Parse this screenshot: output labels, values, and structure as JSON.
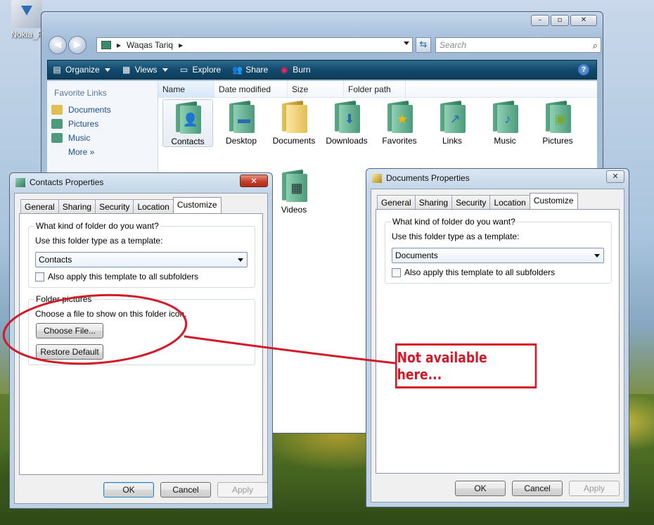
{
  "desktop": {
    "icon_label": "Nokia_P"
  },
  "explorer": {
    "address": [
      "Waqas Tariq"
    ],
    "search_placeholder": "Search",
    "toolbar": [
      {
        "label": "Organize",
        "icon": "organize-icon",
        "dropdown": true
      },
      {
        "label": "Views",
        "icon": "views-icon",
        "dropdown": true
      },
      {
        "label": "Explore",
        "icon": "explore-icon"
      },
      {
        "label": "Share",
        "icon": "share-icon"
      },
      {
        "label": "Burn",
        "icon": "burn-icon"
      }
    ],
    "nav": {
      "heading": "Favorite Links",
      "items": [
        {
          "label": "Documents",
          "icon": "documents-icon",
          "color": "#e2bf55"
        },
        {
          "label": "Pictures",
          "icon": "pictures-icon",
          "color": "#4d9a7c"
        },
        {
          "label": "Music",
          "icon": "music-icon",
          "color": "#4d9a7c"
        },
        {
          "label": "More  »",
          "icon": "",
          "color": ""
        }
      ]
    },
    "columns": [
      "Name",
      "Date modified",
      "Size",
      "Folder path"
    ],
    "files": [
      {
        "label": "Contacts",
        "glyph": "👤",
        "style": "green",
        "selected": true
      },
      {
        "label": "Desktop",
        "glyph": "▭",
        "style": "green"
      },
      {
        "label": "Documents",
        "glyph": "",
        "style": "yellow"
      },
      {
        "label": "Downloads",
        "glyph": "⬇",
        "style": "green"
      },
      {
        "label": "Favorites",
        "glyph": "★",
        "style": "green"
      },
      {
        "label": "Links",
        "glyph": "↗",
        "style": "green"
      },
      {
        "label": "Music",
        "glyph": "♪",
        "style": "green"
      },
      {
        "label": "Pictures",
        "glyph": "▣",
        "style": "green"
      },
      {
        "label": "Videos",
        "glyph": "🎞",
        "style": "green"
      }
    ]
  },
  "contacts_dialog": {
    "title": "Contacts Properties",
    "close_label": "✕",
    "tabs": [
      "General",
      "Sharing",
      "Security",
      "Location",
      "Customize"
    ],
    "group1_title": "What kind of folder do you want?",
    "template_label": "Use this folder type as a template:",
    "template_value": "Contacts",
    "apply_sub_label": "Also apply this template to all subfolders",
    "group2_title": "Folder pictures",
    "choose_text": "Choose a file to show on this folder icon.",
    "choose_btn": "Choose File...",
    "restore_btn": "Restore Default",
    "ok": "OK",
    "cancel": "Cancel",
    "apply": "Apply"
  },
  "documents_dialog": {
    "title": "Documents Properties",
    "close_label": "✕",
    "tabs": [
      "General",
      "Sharing",
      "Security",
      "Location",
      "Customize"
    ],
    "group1_title": "What kind of folder do you want?",
    "template_label": "Use this folder type as a template:",
    "template_value": "Documents",
    "apply_sub_label": "Also apply this template to all subfolders",
    "ok": "OK",
    "cancel": "Cancel",
    "apply": "Apply"
  },
  "annotation": {
    "text": "Not available here...",
    "color": "#d11a2a"
  }
}
